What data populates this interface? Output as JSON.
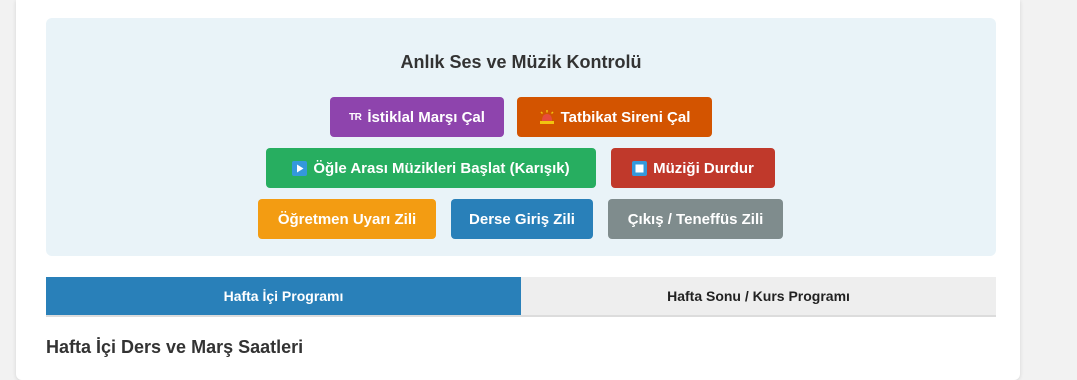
{
  "control_panel": {
    "title": "Anlık Ses ve Müzik Kontrolü",
    "buttons": [
      {
        "id": "istiklal",
        "icon": "TR",
        "label": "İstiklal Marşı Çal",
        "color": "#8e44ad"
      },
      {
        "id": "siren",
        "icon": "siren-icon",
        "label": "Tatbikat Sireni Çal",
        "color": "#d35400"
      },
      {
        "id": "muzik",
        "icon": "play-icon",
        "label": "Öğle Arası Müzikleri Başlat (Karışık)",
        "color": "#27ae60"
      },
      {
        "id": "durdur",
        "icon": "stop-icon",
        "label": "Müziği Durdur",
        "color": "#c0392b"
      },
      {
        "id": "ogretmen",
        "label": "Öğretmen Uyarı Zili",
        "color": "#f39c12"
      },
      {
        "id": "giris",
        "label": "Derse Giriş Zili",
        "color": "#2980b9"
      },
      {
        "id": "cikis",
        "label": "Çıkış / Teneffüs Zili",
        "color": "#7f8c8d"
      }
    ]
  },
  "tabs": [
    {
      "label": "Hafta İçi Programı",
      "active": true
    },
    {
      "label": "Hafta Sonu / Kurs Programı",
      "active": false
    }
  ],
  "section": {
    "heading": "Hafta İçi Ders ve Marş Saatleri"
  }
}
